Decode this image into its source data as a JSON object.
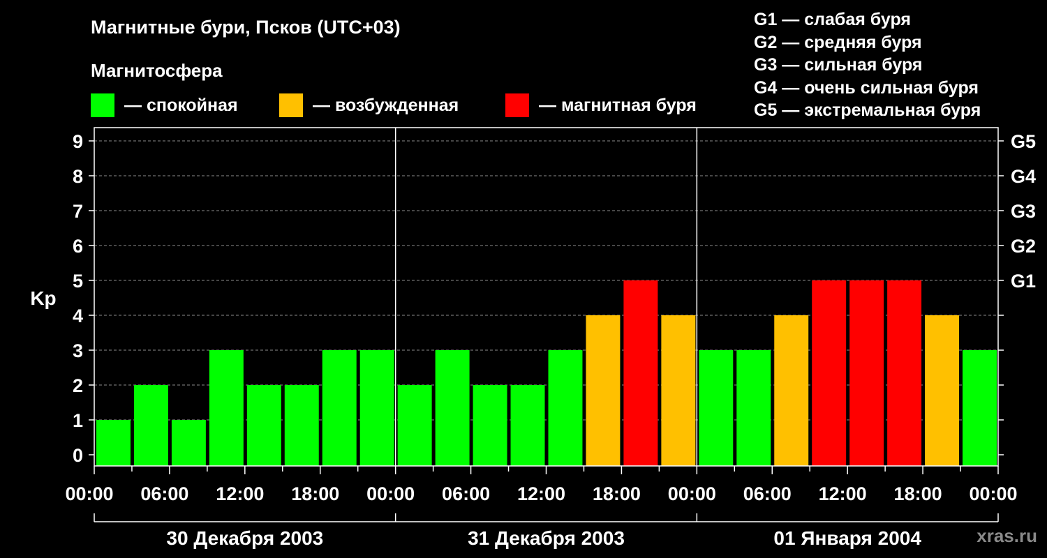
{
  "header": {
    "title": "Магнитные бури, Псков (UTC+03)",
    "subtitle": "Магнитосфера"
  },
  "legend": [
    {
      "label": "— спокойная",
      "color": "#00ff00"
    },
    {
      "label": "— возбужденная",
      "color": "#ffc000"
    },
    {
      "label": "— магнитная буря",
      "color": "#ff0000"
    }
  ],
  "storm_levels": [
    "G1 — слабая буря",
    "G2 — средняя буря",
    "G3 — сильная буря",
    "G4 — очень сильная буря",
    "G5 — экстремальная буря"
  ],
  "watermark": "xras.ru",
  "chart_data": {
    "type": "bar",
    "title": "Магнитные бури, Псков (UTC+03)",
    "ylabel": "Kp",
    "ylim": [
      0,
      9
    ],
    "yticks": [
      "0",
      "1",
      "2",
      "3",
      "4",
      "5",
      "6",
      "7",
      "8",
      "9"
    ],
    "right_ticks": [
      {
        "y": 5,
        "label": "G1"
      },
      {
        "y": 6,
        "label": "G2"
      },
      {
        "y": 7,
        "label": "G3"
      },
      {
        "y": 8,
        "label": "G4"
      },
      {
        "y": 9,
        "label": "G5"
      }
    ],
    "grid": "dashed-horizontal",
    "xticks": [
      "00:00",
      "06:00",
      "12:00",
      "18:00",
      "00:00",
      "06:00",
      "12:00",
      "18:00",
      "00:00",
      "06:00",
      "12:00",
      "18:00",
      "00:00"
    ],
    "days": [
      "30 Декабря 2003",
      "31 Декабря 2003",
      "01 Января 2004"
    ],
    "series": [
      {
        "values": [
          1,
          2,
          1,
          3,
          2,
          2,
          3,
          3,
          2,
          3,
          2,
          2,
          3,
          4,
          5,
          4,
          3,
          3,
          4,
          5,
          5,
          5,
          4,
          3
        ],
        "levels": [
          "calm",
          "calm",
          "calm",
          "calm",
          "calm",
          "calm",
          "calm",
          "calm",
          "calm",
          "calm",
          "calm",
          "calm",
          "calm",
          "excited",
          "storm",
          "excited",
          "calm",
          "calm",
          "excited",
          "storm",
          "storm",
          "storm",
          "excited",
          "calm"
        ]
      }
    ],
    "colors": {
      "calm": "#00ff00",
      "excited": "#ffc000",
      "storm": "#ff0000"
    }
  }
}
